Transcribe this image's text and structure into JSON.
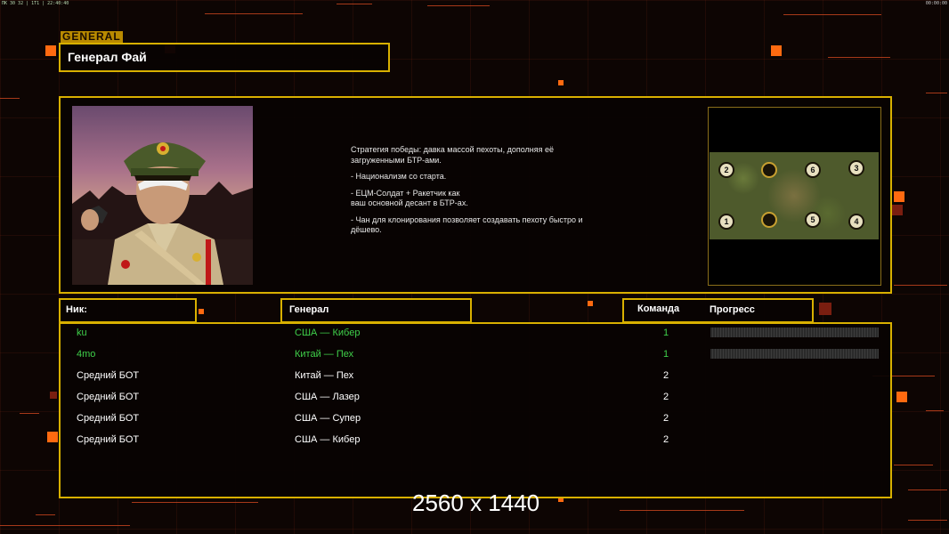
{
  "topbar": {
    "left_text": "ПК 30 32 | 1Т1 | 22:40:40",
    "right_text": "00:00:00"
  },
  "general_tag": "GENERAL",
  "title": "Генерал Фай",
  "strategy": [
    "Стратегия победы: давка массой пехоты, дополняя её\n загруженными БТР-ами.",
    "- Национализм со старта.",
    "- ЕЦМ-Солдат + Ракетчик как\nваш основной десант в БТР-ах.",
    "- Чан для клонирования позволяет создавать пехоту быстро и\n дёшево."
  ],
  "map_slots": [
    "2",
    "",
    "6",
    "3",
    "1",
    "",
    "5",
    "4"
  ],
  "headers": {
    "nick": "Ник:",
    "general": "Генерал",
    "team": "Команда",
    "progress": "Прогресс"
  },
  "players": [
    {
      "nick": "ku",
      "general": "США — Кибер",
      "team": "1",
      "highlight": true,
      "progress": 0
    },
    {
      "nick": "4mo",
      "general": "Китай — Пех",
      "team": "1",
      "highlight": true,
      "progress": 0
    },
    {
      "nick": "Средний БОТ",
      "general": "Китай — Пех",
      "team": "2",
      "highlight": false
    },
    {
      "nick": "Средний БОТ",
      "general": "США — Лазер",
      "team": "2",
      "highlight": false
    },
    {
      "nick": "Средний БОТ",
      "general": "США — Супер",
      "team": "2",
      "highlight": false
    },
    {
      "nick": "Средний БОТ",
      "general": "США — Кибер",
      "team": "2",
      "highlight": false
    }
  ],
  "watermark": "2560 x 1440",
  "colors": {
    "accent_frame": "#d8b000",
    "highlight_text": "#3fd04a",
    "background": "#0d0503"
  }
}
